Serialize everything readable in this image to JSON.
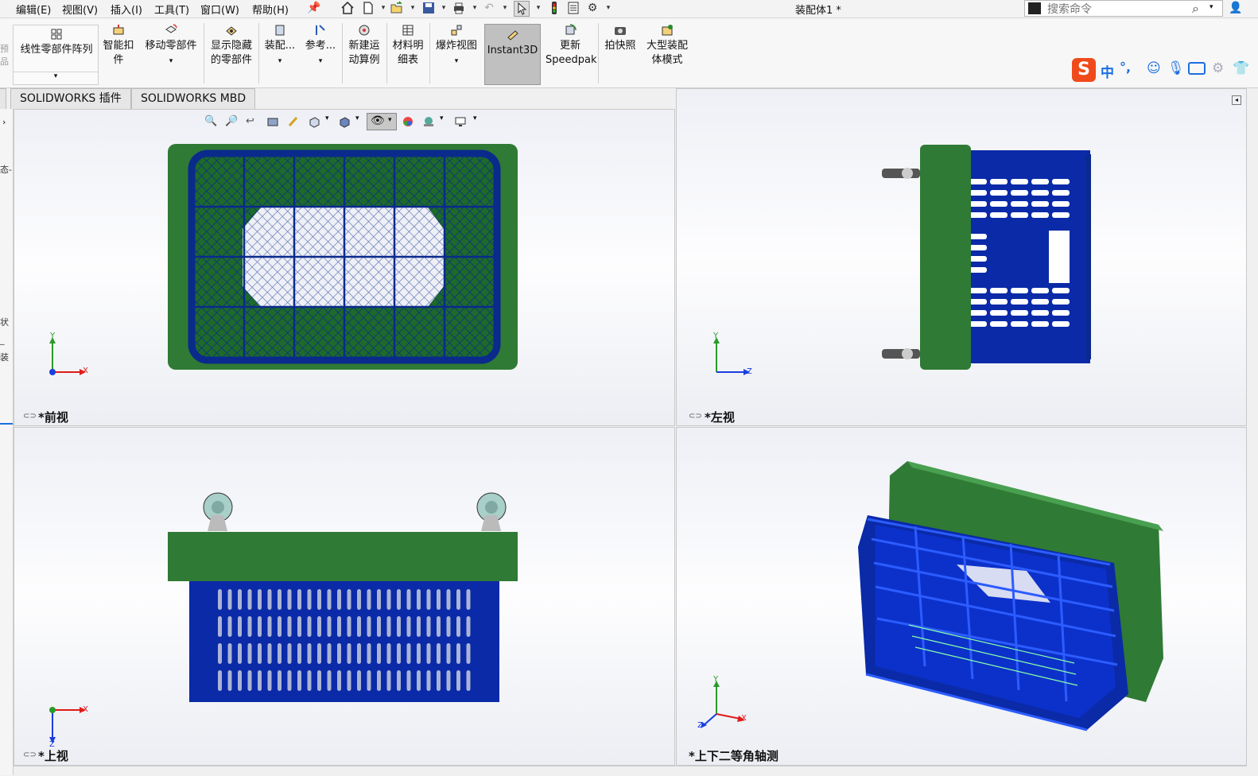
{
  "menu": {
    "items": [
      "编辑(E)",
      "视图(V)",
      "插入(I)",
      "工具(T)",
      "窗口(W)",
      "帮助(H)"
    ]
  },
  "window": {
    "title": "装配体1 *"
  },
  "search": {
    "placeholder": "搜索命令"
  },
  "ribbon": {
    "linear_pattern": "线性零部件阵列",
    "smart_fastener_l1": "智能扣",
    "smart_fastener_l2": "件",
    "move_component": "移动零部件",
    "show_hide_l1": "显示隐藏",
    "show_hide_l2": "的零部件",
    "assembly": "装配...",
    "reference": "参考...",
    "new_motion_l1": "新建运",
    "new_motion_l2": "动算例",
    "bom_l1": "材料明",
    "bom_l2": "细表",
    "exploded_view": "爆炸视图",
    "instant3d": "Instant3D",
    "update_l1": "更新",
    "update_l2": "Speedpak",
    "snapshot": "拍快照",
    "large_assembly_l1": "大型装配",
    "large_assembly_l2": "体模式"
  },
  "tabs": [
    "SOLIDWORKS 插件",
    "SOLIDWORKS MBD"
  ],
  "ime": {
    "lang": "中",
    "punct": "°,"
  },
  "viewports": {
    "front": "*前视",
    "left": "*左视",
    "top": "*上视",
    "iso": "*上下二等角轴测"
  },
  "axes": {
    "x": "X",
    "y": "Y",
    "z": "Z"
  },
  "colors": {
    "crate_blue": "#0a2a8c",
    "crate_blue_bright": "#1a3ee0",
    "lid_green": "#2f7a35",
    "accent_red": "#e01a1a"
  }
}
